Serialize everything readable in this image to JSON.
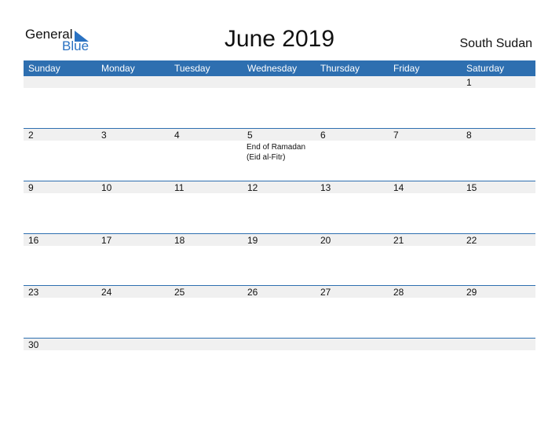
{
  "brand": {
    "word1": "General",
    "word2": "Blue"
  },
  "title": "June 2019",
  "country": "South Sudan",
  "colors": {
    "header": "#2e6fb0",
    "band": "#f0f0f0",
    "accent": "#2a72c2"
  },
  "weekdays": [
    "Sunday",
    "Monday",
    "Tuesday",
    "Wednesday",
    "Thursday",
    "Friday",
    "Saturday"
  ],
  "weeks": [
    [
      "",
      "",
      "",
      "",
      "",
      "",
      "1"
    ],
    [
      "2",
      "3",
      "4",
      "5",
      "6",
      "7",
      "8"
    ],
    [
      "9",
      "10",
      "11",
      "12",
      "13",
      "14",
      "15"
    ],
    [
      "16",
      "17",
      "18",
      "19",
      "20",
      "21",
      "22"
    ],
    [
      "23",
      "24",
      "25",
      "26",
      "27",
      "28",
      "29"
    ],
    [
      "30",
      "",
      "",
      "",
      "",
      "",
      ""
    ]
  ],
  "events": [
    {
      "week": 1,
      "day": 3,
      "text": "End of Ramadan (Eid al-Fitr)"
    }
  ]
}
